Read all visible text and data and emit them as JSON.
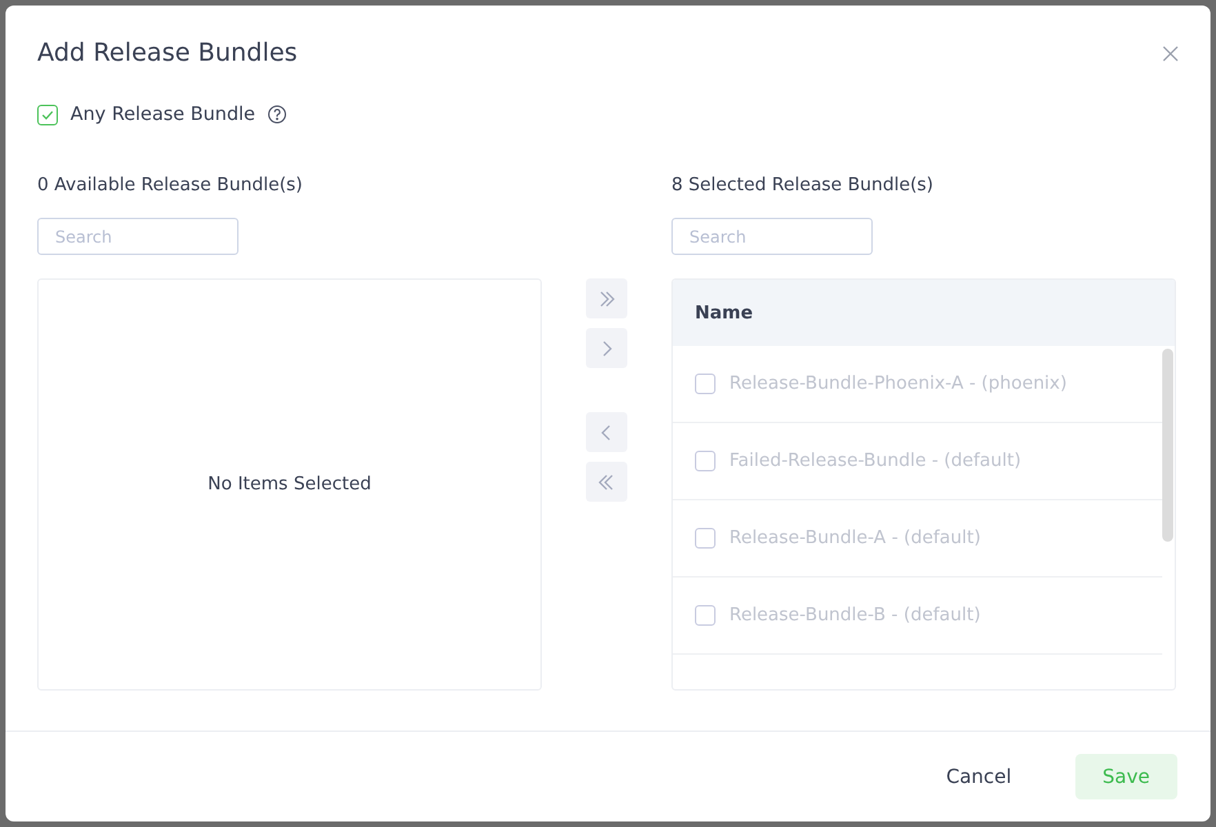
{
  "dialog": {
    "title": "Add Release Bundles"
  },
  "any_release_bundle": {
    "label": "Any Release Bundle",
    "checked": true
  },
  "available": {
    "heading": "0 Available Release Bundle(s)",
    "search": {
      "placeholder": "Search"
    },
    "empty_text": "No Items Selected"
  },
  "transfer_buttons": [
    {
      "kind": "all-right"
    },
    {
      "kind": "right"
    },
    {
      "kind": "left"
    },
    {
      "kind": "all-left"
    }
  ],
  "selected": {
    "heading": "8 Selected Release Bundle(s)",
    "search": {
      "placeholder": "Search"
    },
    "column": "Name",
    "rows": [
      {
        "name": "Release-Bundle-Phoenix-A - (phoenix)",
        "checked": false,
        "disabled": true
      },
      {
        "name": "Failed-Release-Bundle - (default)",
        "checked": false,
        "disabled": true
      },
      {
        "name": "Release-Bundle-A - (default)",
        "checked": false,
        "disabled": true
      },
      {
        "name": "Release-Bundle-B - (default)",
        "checked": false,
        "disabled": true
      }
    ]
  },
  "buttons": [
    {
      "kind": "secondary",
      "label": "Cancel"
    },
    {
      "kind": "primary",
      "label": "Save"
    }
  ]
}
